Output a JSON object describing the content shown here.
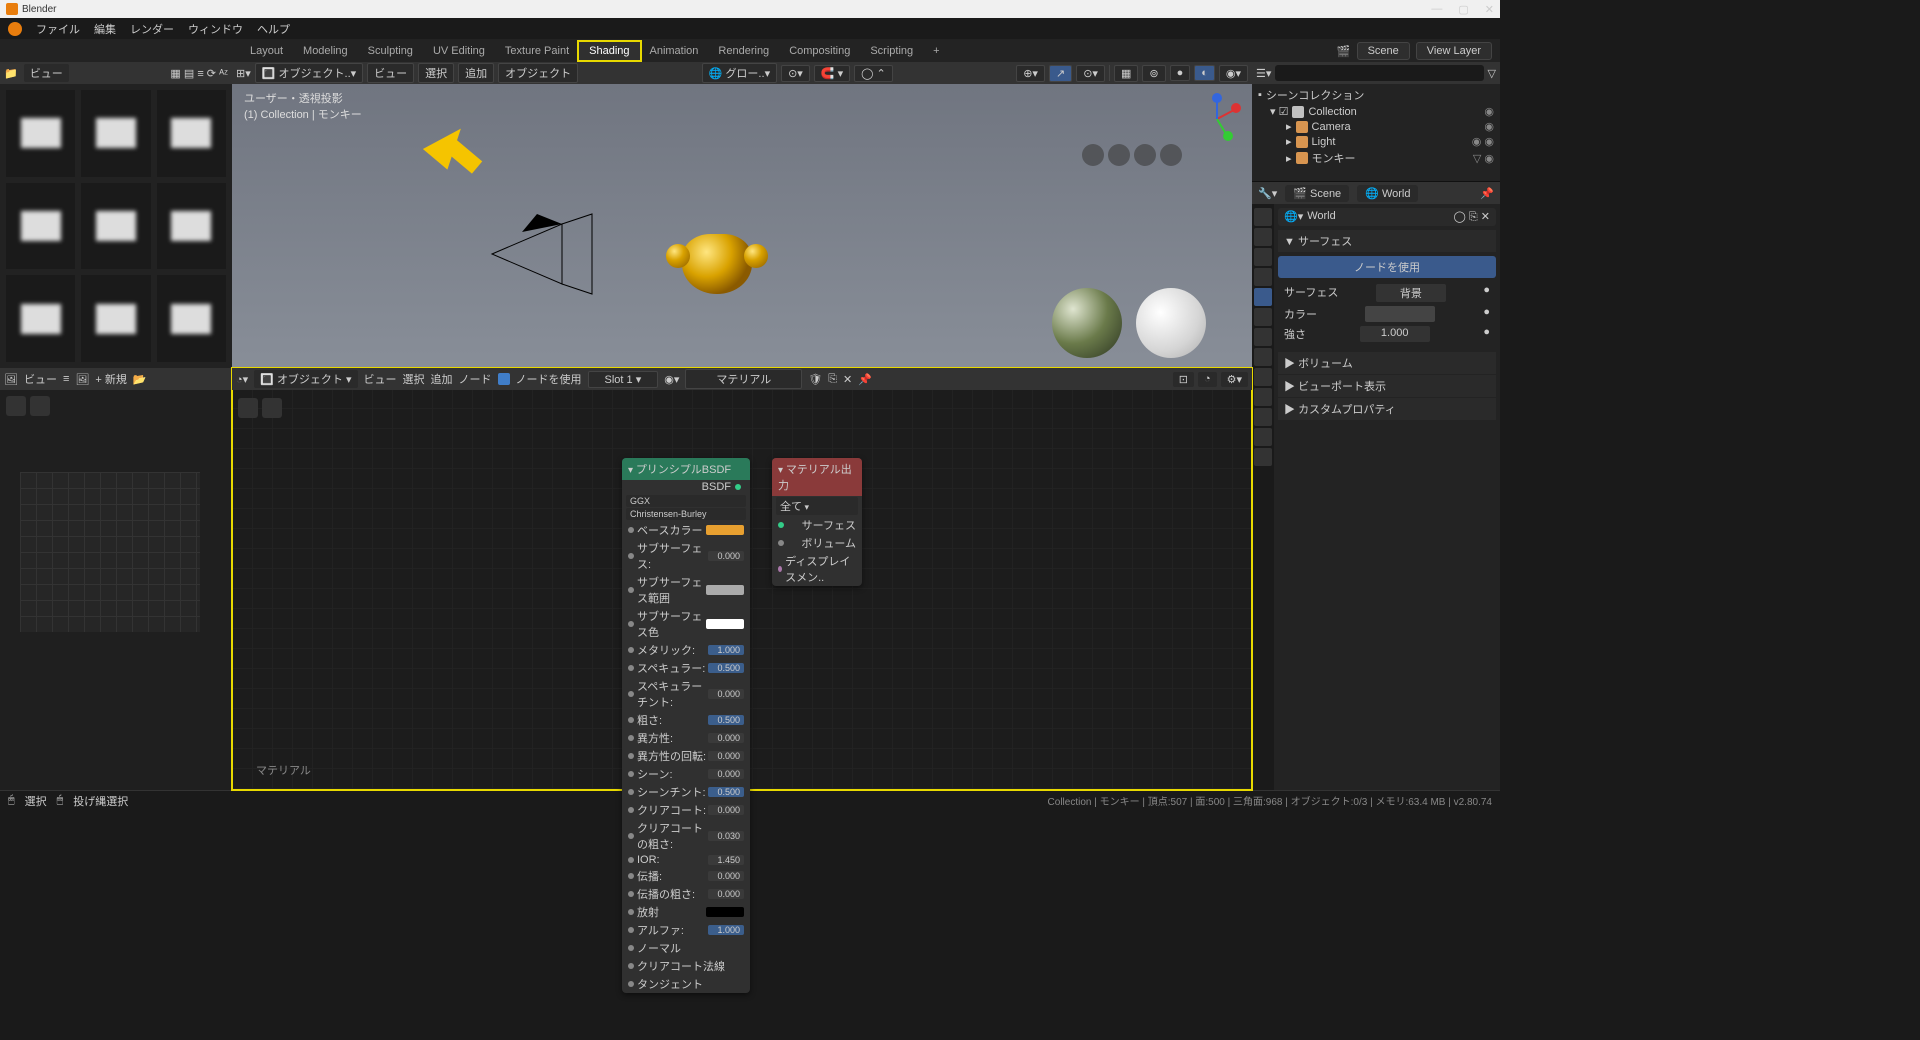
{
  "app": {
    "title": "Blender"
  },
  "menu": [
    "ファイル",
    "編集",
    "レンダー",
    "ウィンドウ",
    "ヘルプ"
  ],
  "workspaces": [
    "Layout",
    "Modeling",
    "Sculpting",
    "UV Editing",
    "Texture Paint",
    "Shading",
    "Animation",
    "Rendering",
    "Compositing",
    "Scripting"
  ],
  "workspace_active": "Shading",
  "topbar": {
    "scene_label": "Scene",
    "scene_value": "Scene",
    "layer_label": "View Layer"
  },
  "filebrowser": {
    "view": "ビュー"
  },
  "viewport": {
    "mode": "オブジェクト..",
    "menus": [
      "ビュー",
      "選択",
      "追加",
      "オブジェクト"
    ],
    "transform": "グロー..",
    "info1": "ユーザー・透視投影",
    "info2": "(1) Collection | モンキー"
  },
  "image_editor": {
    "menus": [
      "ビュー"
    ],
    "new": "新規"
  },
  "node_editor": {
    "mode": "オブジェクト",
    "menus": [
      "ビュー",
      "選択",
      "追加",
      "ノード"
    ],
    "use_nodes": "ノードを使用",
    "slot": "Slot 1",
    "material": "マテリアル",
    "footer": "マテリアル"
  },
  "bsdf": {
    "title": "プリンシプルBSDF",
    "out": "BSDF",
    "dist": "GGX",
    "sss": "Christensen-Burley",
    "rows": [
      {
        "l": "ベースカラー",
        "t": "color",
        "c": "#e8a030"
      },
      {
        "l": "サブサーフェス:",
        "v": "0.000"
      },
      {
        "l": "サブサーフェス範囲",
        "t": "color",
        "c": "#aaa"
      },
      {
        "l": "サブサーフェス色",
        "t": "color",
        "c": "#fff"
      },
      {
        "l": "メタリック:",
        "v": "1.000",
        "hl": 1
      },
      {
        "l": "スペキュラー:",
        "v": "0.500",
        "hl": 1
      },
      {
        "l": "スペキュラーチント:",
        "v": "0.000"
      },
      {
        "l": "粗さ:",
        "v": "0.500",
        "hl": 1
      },
      {
        "l": "異方性:",
        "v": "0.000"
      },
      {
        "l": "異方性の回転:",
        "v": "0.000"
      },
      {
        "l": "シーン:",
        "v": "0.000"
      },
      {
        "l": "シーンチント:",
        "v": "0.500",
        "hl": 1
      },
      {
        "l": "クリアコート:",
        "v": "0.000"
      },
      {
        "l": "クリアコートの粗さ:",
        "v": "0.030"
      },
      {
        "l": "IOR:",
        "v": "1.450"
      },
      {
        "l": "伝播:",
        "v": "0.000"
      },
      {
        "l": "伝播の粗さ:",
        "v": "0.000"
      },
      {
        "l": "放射",
        "t": "color",
        "c": "#000"
      },
      {
        "l": "アルファ:",
        "v": "1.000",
        "hl": 1
      },
      {
        "l": "ノーマル"
      },
      {
        "l": "クリアコート法線"
      },
      {
        "l": "タンジェント"
      }
    ]
  },
  "matout": {
    "title": "マテリアル出力",
    "target": "全て",
    "ins": [
      "サーフェス",
      "ボリューム",
      "ディスプレイスメン.."
    ]
  },
  "outliner": {
    "root": "シーンコレクション",
    "items": [
      {
        "l": "Collection",
        "ic": "#c0c0c0"
      },
      {
        "l": "Camera",
        "ic": "#d89550",
        "ind": 1
      },
      {
        "l": "Light",
        "ic": "#d89550",
        "ind": 1
      },
      {
        "l": "モンキー",
        "ic": "#d89550",
        "ind": 1
      }
    ]
  },
  "properties": {
    "context": "Scene",
    "world_tab": "World",
    "world": "World",
    "surface_h": "サーフェス",
    "use_nodes": "ノードを使用",
    "surface_l": "サーフェス",
    "surface_v": "背景",
    "color_l": "カラー",
    "strength_l": "強さ",
    "strength_v": "1.000",
    "volume": "ボリューム",
    "vp": "ビューポート表示",
    "custom": "カスタムプロパティ"
  },
  "status": {
    "left1": "選択",
    "left2": "投げ縄選択",
    "right": "Collection | モンキー | 頂点:507 | 面:500 | 三角面:968 | オブジェクト:0/3 | メモリ:63.4 MB | v2.80.74"
  }
}
